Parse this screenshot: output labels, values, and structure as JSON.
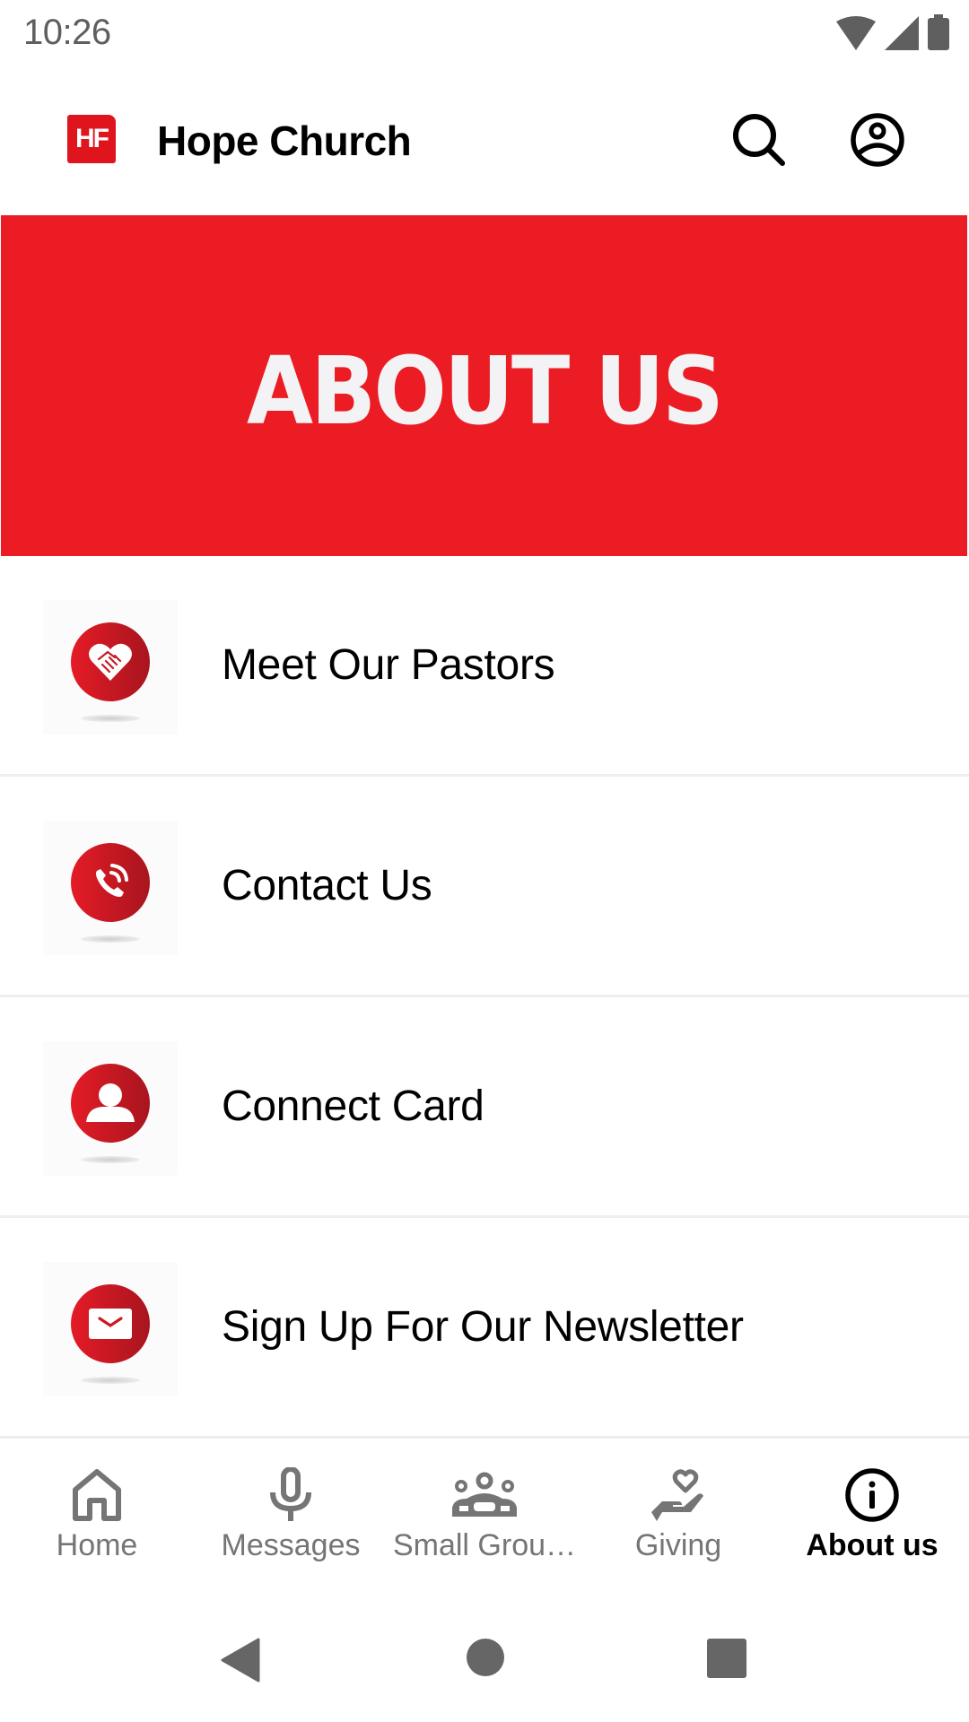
{
  "status_bar": {
    "time": "10:26",
    "icons": [
      "wifi-icon",
      "signal-icon",
      "battery-icon"
    ]
  },
  "app_bar": {
    "logo_text": "HF",
    "title": "Hope Church",
    "actions": [
      {
        "icon": "search-icon"
      },
      {
        "icon": "account-circle-icon"
      }
    ]
  },
  "banner": {
    "text": "ABOUT US",
    "background_color": "#ec1c24"
  },
  "menu": {
    "items": [
      {
        "label": "Meet Our Pastors",
        "icon": "handshake-heart-icon"
      },
      {
        "label": "Contact Us",
        "icon": "phone-call-icon"
      },
      {
        "label": "Connect Card",
        "icon": "person-icon"
      },
      {
        "label": "Sign Up For Our Newsletter",
        "icon": "envelope-icon"
      }
    ]
  },
  "bottom_nav": {
    "items": [
      {
        "label": "Home",
        "icon": "home-icon",
        "active": false
      },
      {
        "label": "Messages",
        "icon": "microphone-icon",
        "active": false
      },
      {
        "label": "Small Grou…",
        "icon": "groups-icon",
        "active": false
      },
      {
        "label": "Giving",
        "icon": "giving-hand-heart-icon",
        "active": false
      },
      {
        "label": "About us",
        "icon": "info-icon",
        "active": true
      }
    ]
  },
  "colors": {
    "accent": "#ec1c24",
    "icon_gradient_start": "#e41b26",
    "icon_gradient_end": "#a8151f",
    "nav_inactive": "#757575",
    "nav_active": "#000000",
    "divider": "#eeeeee"
  }
}
